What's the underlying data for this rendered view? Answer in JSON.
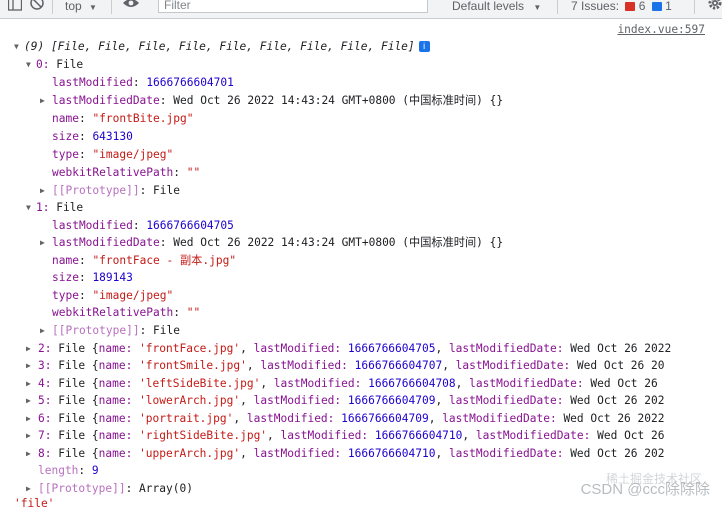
{
  "toolbar": {
    "context_label": "top",
    "filter_placeholder": "Filter",
    "levels_label": "Default levels",
    "issues_label": "7 Issues:",
    "errors_count": "6",
    "info_count": "1"
  },
  "console": {
    "source_link": "index.vue:597",
    "array_summary": "(9) [File, File, File, File, File, File, File, File, File]",
    "entries": [
      {
        "key": "0: ",
        "type_label": "File",
        "lastModified": "1666766604701",
        "lastModifiedDate": "Wed Oct 26 2022 14:43:24 GMT+0800 (中国标准时间) {}",
        "name": "\"frontBite.jpg\"",
        "size": "643130",
        "type": "\"image/jpeg\"",
        "webkitRelativePath": "\"\"",
        "prototype": "File"
      },
      {
        "key": "1: ",
        "type_label": "File",
        "lastModified": "1666766604705",
        "lastModifiedDate": "Wed Oct 26 2022 14:43:24 GMT+0800 (中国标准时间) {}",
        "name": "\"frontFace - 副本.jpg\"",
        "size": "189143",
        "type": "\"image/jpeg\"",
        "webkitRelativePath": "\"\"",
        "prototype": "File"
      }
    ],
    "prop_labels": {
      "lastModified": "lastModified",
      "lastModifiedDate": "lastModifiedDate",
      "name": "name",
      "size": "size",
      "type": "type",
      "webkitRelativePath": "webkitRelativePath",
      "prototype": "[[Prototype]]"
    },
    "collapsed": [
      {
        "key": "2: ",
        "name": "'frontFace.jpg'",
        "lastModified": "1666766604705",
        "date": "Wed Oct 26 2022"
      },
      {
        "key": "3: ",
        "name": "'frontSmile.jpg'",
        "lastModified": "1666766604707",
        "date": "Wed Oct 26 20"
      },
      {
        "key": "4: ",
        "name": "'leftSideBite.jpg'",
        "lastModified": "1666766604708",
        "date": "Wed Oct 26"
      },
      {
        "key": "5: ",
        "name": "'lowerArch.jpg'",
        "lastModified": "1666766604709",
        "date": "Wed Oct 26 202"
      },
      {
        "key": "6: ",
        "name": "'portrait.jpg'",
        "lastModified": "1666766604709",
        "date": "Wed Oct 26 2022"
      },
      {
        "key": "7: ",
        "name": "'rightSideBite.jpg'",
        "lastModified": "1666766604710",
        "date": "Wed Oct 26"
      },
      {
        "key": "8: ",
        "name": "'upperArch.jpg'",
        "lastModified": "1666766604710",
        "date": "Wed Oct 26 202"
      }
    ],
    "collapsed_prefix": "File {",
    "collapsed_name_key": "name: ",
    "collapsed_lm_key": "lastModified: ",
    "collapsed_lmd_key": "lastModifiedDate: ",
    "length_label": "length",
    "length_value": "9",
    "array_prototype": "Array(0)",
    "last_output": "'file'"
  },
  "watermark": {
    "line1": "稀土掘金技术社区",
    "line2": "CSDN @ccc除除除"
  },
  "icons": [
    "sidebar-icon",
    "clear-console-icon",
    "dropdown-caret-icon",
    "eye-icon",
    "error-badge-icon",
    "info-badge-icon",
    "settings-gear-icon",
    "expand-arrow-icon",
    "info-icon"
  ],
  "colors": {
    "key": "#881391",
    "string": "#c41a16",
    "number": "#1c00cf",
    "error_badge": "#d93025",
    "info_badge": "#1a73e8"
  }
}
